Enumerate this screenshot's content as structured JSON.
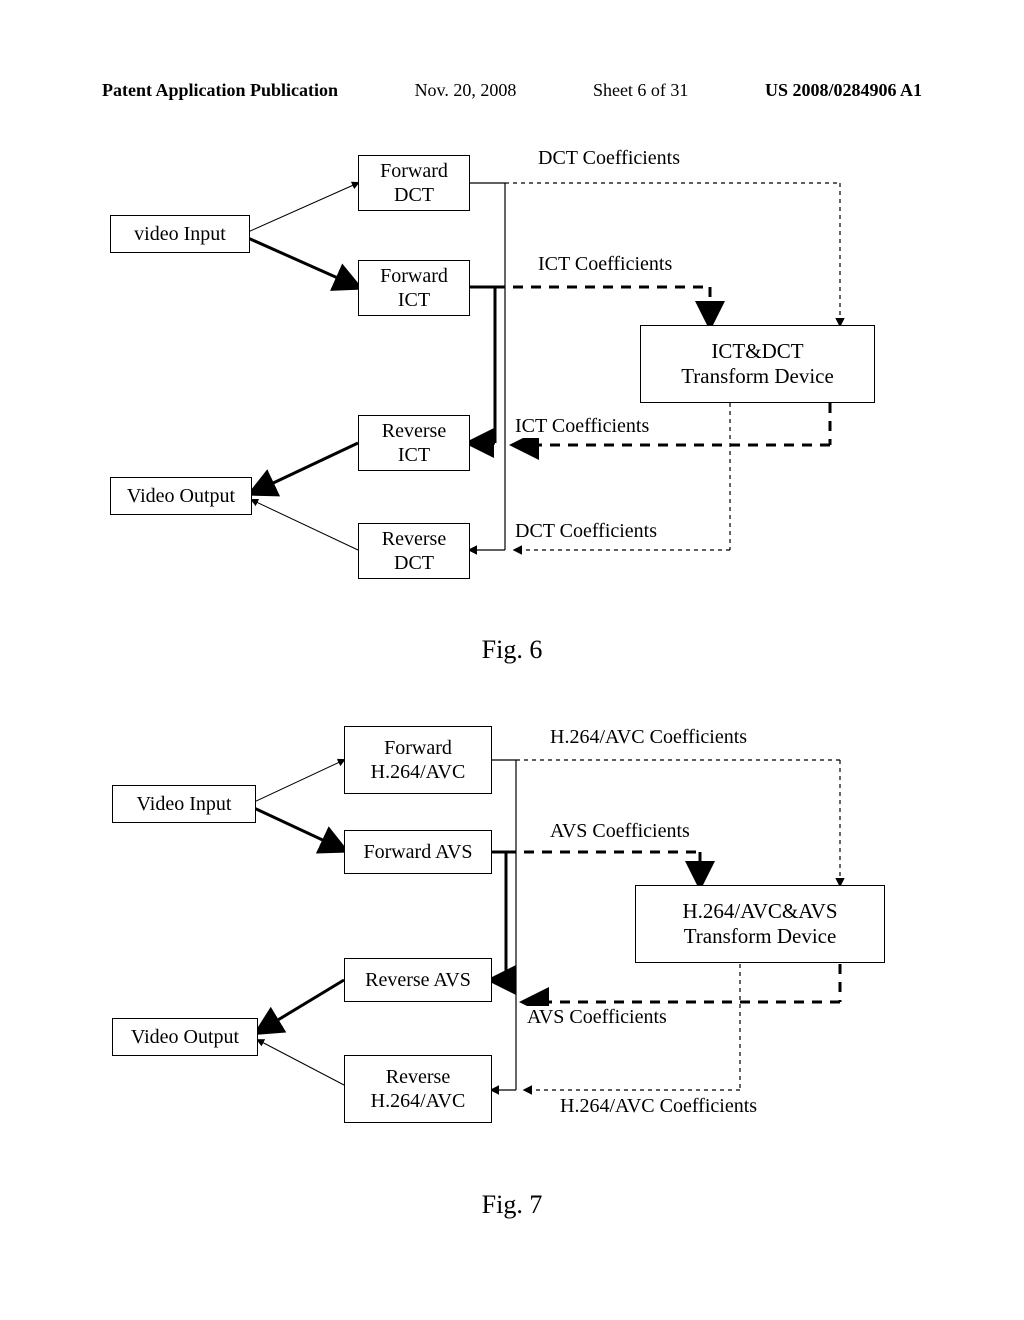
{
  "header": {
    "publication": "Patent Application Publication",
    "date": "Nov. 20, 2008",
    "sheet": "Sheet 6 of 31",
    "number": "US 2008/0284906 A1"
  },
  "fig6": {
    "videoInput": "video Input",
    "videoOutput": "Video Output",
    "forwardDCT_l1": "Forward",
    "forwardDCT_l2": "DCT",
    "forwardICT_l1": "Forward",
    "forwardICT_l2": "ICT",
    "reverseICT_l1": "Reverse",
    "reverseICT_l2": "ICT",
    "reverseDCT_l1": "Reverse",
    "reverseDCT_l2": "DCT",
    "device_l1": "ICT&DCT",
    "device_l2": "Transform Device",
    "dctCoefTop": "DCT Coefficients",
    "ictCoefTop": "ICT Coefficients",
    "ictCoefBot": "ICT Coefficients",
    "dctCoefBot": "DCT Coefficients",
    "caption": "Fig. 6"
  },
  "fig7": {
    "videoInput": "Video Input",
    "videoOutput": "Video Output",
    "forwardH264_l1": "Forward",
    "forwardH264_l2": "H.264/AVC",
    "forwardAVS": "Forward AVS",
    "reverseAVS": "Reverse AVS",
    "reverseH264_l1": "Reverse",
    "reverseH264_l2": "H.264/AVC",
    "device_l1": "H.264/AVC&AVS",
    "device_l2": "Transform Device",
    "h264CoefTop": "H.264/AVC Coefficients",
    "avsCoefTop": "AVS Coefficients",
    "avsCoefBot": "AVS Coefficients",
    "h264CoefBot": "H.264/AVC Coefficients",
    "caption": "Fig. 7"
  }
}
